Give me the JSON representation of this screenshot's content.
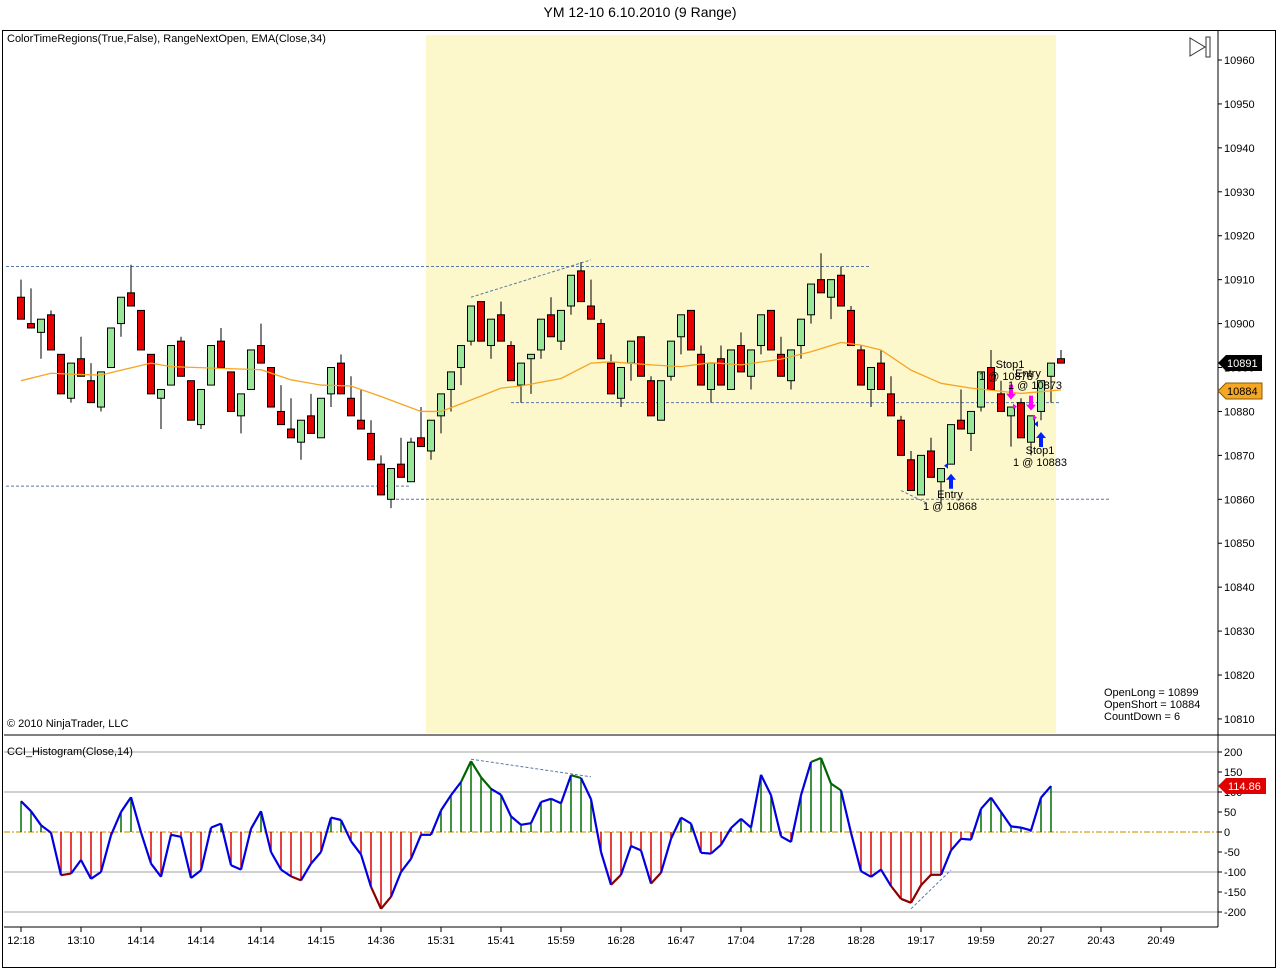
{
  "window": {
    "title": "YM 12-10  6.10.2010 (9 Range)"
  },
  "price_panel": {
    "indicator_label": "ColorTimeRegions(True,False), RangeNextOpen, EMA(Close,34)",
    "copyright": "© 2010 NinjaTrader, LLC",
    "info": [
      "OpenLong = 10899",
      "OpenShort = 10884",
      "CountDown = 6"
    ],
    "last_price_label": "10891",
    "ema_label": "10884",
    "trade_labels": [
      {
        "name": "Entry",
        "detail": "1 @ 10868",
        "bar": 92,
        "price": 10860
      },
      {
        "name": "Stop1",
        "detail": "1 @ 10878",
        "bar": 97,
        "price": 10894
      },
      {
        "name": "Entry",
        "detail": "1 @ 10873",
        "bar": 100,
        "price": 10891
      },
      {
        "name": "Stop1",
        "detail": "1 @ 10883",
        "bar": 101,
        "price": 10868
      }
    ]
  },
  "cci_panel": {
    "indicator_label": "CCI_Histogram(Close,14)",
    "last_value_label": "114.86"
  },
  "colors": {
    "up": "#99e699",
    "down": "#e60000",
    "ema": "#f5a623",
    "session": "#fdf7cc",
    "cci_line": "#0000e0",
    "cci_pos": "#007000",
    "cci_neg": "#e00000"
  },
  "chart_data": [
    {
      "type": "candlestick",
      "title": "YM 12-10  6.10.2010 (9 Range)",
      "ylim": [
        10805,
        10966
      ],
      "yticks": [
        "10960",
        "10950",
        "10940",
        "10930",
        "10920",
        "10910",
        "10900",
        "10890",
        "10880",
        "10870",
        "10860",
        "10850",
        "10840",
        "10830",
        "10820",
        "10810"
      ],
      "ytick_values": [
        10960,
        10950,
        10940,
        10930,
        10920,
        10910,
        10900,
        10890,
        10880,
        10870,
        10860,
        10850,
        10840,
        10830,
        10820,
        10810
      ],
      "xticks": [
        "12:18",
        "13:10",
        "14:14",
        "14:14",
        "14:14",
        "14:15",
        "14:36",
        "15:31",
        "15:41",
        "15:59",
        "16:28",
        "16:47",
        "17:04",
        "17:28",
        "18:28",
        "19:17",
        "19:59",
        "20:27",
        "20:43",
        "20:49"
      ],
      "xtick_every_bars": 6,
      "session_region_bars": [
        40.5,
        103.5
      ],
      "ohlc": [
        [
          10906,
          10910,
          10901,
          10901
        ],
        [
          10900,
          10908,
          10899,
          10899
        ],
        [
          10898,
          10901,
          10892,
          10901
        ],
        [
          10902,
          10903,
          10894,
          10894
        ],
        [
          10893,
          10893,
          10884,
          10884
        ],
        [
          10883,
          10891,
          10882,
          10891
        ],
        [
          10892,
          10897,
          10888,
          10888
        ],
        [
          10887,
          10891,
          10882,
          10882
        ],
        [
          10881,
          10889,
          10880,
          10889
        ],
        [
          10890,
          10899,
          10890,
          10899
        ],
        [
          10900,
          10906,
          10897,
          10906
        ],
        [
          10907,
          10913.4,
          10904,
          10904
        ],
        [
          10903,
          10903,
          10894,
          10894
        ],
        [
          10893,
          10893,
          10884,
          10884
        ],
        [
          10883,
          10885,
          10876,
          10885
        ],
        [
          10886,
          10895,
          10886,
          10895
        ],
        [
          10896,
          10897,
          10888,
          10888
        ],
        [
          10887,
          10887,
          10878,
          10878
        ],
        [
          10877,
          10885,
          10876,
          10885
        ],
        [
          10886,
          10895,
          10886,
          10895
        ],
        [
          10896,
          10899,
          10890,
          10890
        ],
        [
          10889,
          10889,
          10880,
          10880
        ],
        [
          10879,
          10884,
          10875,
          10884
        ],
        [
          10885,
          10894,
          10885,
          10894
        ],
        [
          10895,
          10900,
          10891,
          10891
        ],
        [
          10890,
          10890,
          10881,
          10881
        ],
        [
          10880,
          10886,
          10877,
          10877
        ],
        [
          10876,
          10883,
          10874,
          10874
        ],
        [
          10873,
          10878,
          10869,
          10878
        ],
        [
          10879,
          10884,
          10875,
          10875
        ],
        [
          10874,
          10883,
          10874,
          10883
        ],
        [
          10884,
          10890,
          10881,
          10890
        ],
        [
          10891,
          10893,
          10884,
          10884
        ],
        [
          10883,
          10888,
          10879,
          10879
        ],
        [
          10878,
          10885,
          10876,
          10876
        ],
        [
          10875,
          10878,
          10869,
          10869
        ],
        [
          10868,
          10870,
          10861,
          10861
        ],
        [
          10860,
          10867,
          10858,
          10867
        ],
        [
          10868,
          10874,
          10865,
          10865
        ],
        [
          10864,
          10874,
          10864,
          10873
        ],
        [
          10874,
          10881,
          10872,
          10872
        ],
        [
          10871,
          10878,
          10869,
          10878
        ],
        [
          10879,
          10884,
          10875,
          10884
        ],
        [
          10885,
          10889,
          10880,
          10889
        ],
        [
          10890,
          10895,
          10886,
          10895
        ],
        [
          10896,
          10904,
          10895,
          10904
        ],
        [
          10905,
          10905,
          10896,
          10896
        ],
        [
          10895,
          10901,
          10892,
          10901
        ],
        [
          10902,
          10905,
          10896,
          10896
        ],
        [
          10895,
          10896,
          10887,
          10887
        ],
        [
          10886,
          10891,
          10882,
          10891
        ],
        [
          10892,
          10893,
          10884,
          10893
        ],
        [
          10894,
          10901,
          10892,
          10901
        ],
        [
          10902,
          10906,
          10897,
          10897
        ],
        [
          10896,
          10903,
          10894,
          10903
        ],
        [
          10904,
          10911,
          10902,
          10911
        ],
        [
          10912,
          10914,
          10905,
          10905
        ],
        [
          10904,
          10910,
          10901,
          10901
        ],
        [
          10900,
          10901,
          10892,
          10892
        ],
        [
          10891,
          10893,
          10884,
          10884
        ],
        [
          10883,
          10890,
          10881,
          10890
        ],
        [
          10891,
          10896,
          10887,
          10896
        ],
        [
          10897,
          10897,
          10888,
          10888
        ],
        [
          10887,
          10888,
          10879,
          10879
        ],
        [
          10878,
          10887,
          10878,
          10887
        ],
        [
          10888,
          10896,
          10887,
          10896
        ],
        [
          10897,
          10902,
          10893,
          10902
        ],
        [
          10903,
          10903,
          10894,
          10894
        ],
        [
          10893,
          10895,
          10886,
          10886
        ],
        [
          10885,
          10891,
          10882,
          10891
        ],
        [
          10892,
          10895,
          10886,
          10886
        ],
        [
          10885,
          10894,
          10885,
          10894
        ],
        [
          10895,
          10898,
          10889,
          10889
        ],
        [
          10888,
          10894,
          10885,
          10894
        ],
        [
          10895,
          10902,
          10893,
          10902
        ],
        [
          10903,
          10903,
          10894,
          10894
        ],
        [
          10893,
          10897,
          10888,
          10888
        ],
        [
          10887,
          10894,
          10885,
          10894
        ],
        [
          10895,
          10901,
          10892,
          10901
        ],
        [
          10902,
          10909,
          10900,
          10909
        ],
        [
          10910,
          10916,
          10907,
          10907
        ],
        [
          10906,
          10910,
          10901,
          10910
        ],
        [
          10911,
          10913,
          10904,
          10904
        ],
        [
          10903,
          10904,
          10895,
          10895
        ],
        [
          10894,
          10895,
          10886,
          10886
        ],
        [
          10885,
          10890,
          10881,
          10890
        ],
        [
          10891,
          10894,
          10885,
          10885
        ],
        [
          10884,
          10888,
          10879,
          10879
        ],
        [
          10878,
          10879,
          10870,
          10870
        ],
        [
          10869,
          10871,
          10862,
          10862
        ],
        [
          10861,
          10870,
          10861,
          10870
        ],
        [
          10871,
          10874,
          10865,
          10865
        ],
        [
          10864,
          10867,
          10859,
          10867
        ],
        [
          10868,
          10877,
          10868,
          10877
        ],
        [
          10878,
          10885,
          10876,
          10876
        ],
        [
          10875,
          10880,
          10871,
          10880
        ],
        [
          10881,
          10889,
          10880,
          10889
        ],
        [
          10890,
          10894,
          10885,
          10885
        ],
        [
          10884,
          10887,
          10880,
          10880
        ],
        [
          10879,
          10881,
          10872,
          10881
        ],
        [
          10882,
          10883,
          10874,
          10874
        ],
        [
          10873,
          10879,
          10870,
          10879
        ],
        [
          10880,
          10887,
          10878,
          10887
        ],
        [
          10888,
          10891,
          10882,
          10891
        ],
        [
          10892,
          10894,
          10891,
          10891
        ]
      ],
      "ema34": [
        [
          0,
          10887
        ],
        [
          3,
          10888.7
        ],
        [
          6,
          10888.4
        ],
        [
          8,
          10888.3
        ],
        [
          13,
          10891
        ],
        [
          15,
          10890.2
        ],
        [
          20,
          10889.8
        ],
        [
          24,
          10889.5
        ],
        [
          27,
          10887.2
        ],
        [
          30,
          10886
        ],
        [
          33,
          10885.8
        ],
        [
          36,
          10883.4
        ],
        [
          40,
          10880
        ],
        [
          42,
          10880
        ],
        [
          45,
          10882.6
        ],
        [
          48,
          10885.3
        ],
        [
          50,
          10885.8
        ],
        [
          54,
          10887.5
        ],
        [
          57,
          10891
        ],
        [
          59,
          10891.3
        ],
        [
          63,
          10890.6
        ],
        [
          66,
          10890.2
        ],
        [
          69,
          10891.1
        ],
        [
          72,
          10890.6
        ],
        [
          76,
          10891.9
        ],
        [
          79,
          10893.6
        ],
        [
          82,
          10895.7
        ],
        [
          84,
          10895.1
        ],
        [
          86,
          10894
        ],
        [
          89,
          10889.4
        ],
        [
          92,
          10886.4
        ],
        [
          95,
          10885.3
        ],
        [
          100,
          10884.1
        ],
        [
          104,
          10884.9
        ]
      ],
      "horizontal_lines": [
        {
          "price": 10913,
          "from_bar": -1.5,
          "to_bar": 85
        },
        {
          "price": 10863,
          "from_bar": -1.5,
          "to_bar": 39
        },
        {
          "price": 10882,
          "from_bar": 49,
          "to_bar": 104
        },
        {
          "price": 10860,
          "from_bar": 37,
          "to_bar": 109
        }
      ],
      "trend_lines": [
        {
          "from": [
            45,
            10906
          ],
          "to": [
            57,
            10914.5
          ]
        },
        {
          "from": [
            88,
            10862
          ],
          "to": [
            90.7,
            10859
          ]
        }
      ],
      "markers": [
        {
          "type": "long-entry-arrow",
          "bar": 93,
          "price": 10864
        },
        {
          "type": "long-entry-arrow",
          "bar": 102,
          "price": 10873.5
        },
        {
          "type": "short-exit-arrow",
          "bar": 99,
          "price": 10884.5
        },
        {
          "type": "short-exit-arrow",
          "bar": 101,
          "price": 10882
        }
      ]
    },
    {
      "type": "bar+line",
      "title": "CCI_Histogram(Close,14)",
      "ylim": [
        -240,
        230
      ],
      "yticks": [
        "200",
        "150",
        "100",
        "50",
        "0",
        "-50",
        "-100",
        "-150",
        "-200"
      ],
      "ytick_values": [
        200,
        150,
        100,
        50,
        0,
        -50,
        -100,
        -150,
        -200
      ],
      "gridlines": [
        200,
        100,
        -100,
        -200
      ],
      "values": [
        77,
        52,
        17,
        -2,
        -108,
        -104,
        -70,
        -117,
        -100,
        -8,
        50,
        87,
        -1,
        -79,
        -112,
        -7,
        -12,
        -115,
        -96,
        11,
        21,
        -83,
        -94,
        8,
        52,
        -50,
        -94,
        -111,
        -121,
        -79,
        -50,
        36,
        30,
        -23,
        -56,
        -137,
        -192,
        -162,
        -100,
        -67,
        -7,
        -7,
        54,
        92,
        125,
        177,
        137,
        108,
        93,
        39,
        18,
        22,
        75,
        83,
        72,
        142,
        135,
        82,
        -50,
        -132,
        -107,
        -35,
        -46,
        -129,
        -102,
        -17,
        36,
        21,
        -52,
        -54,
        -32,
        10,
        33,
        11,
        143,
        92,
        -11,
        -25,
        92,
        175,
        185,
        121,
        104,
        -2,
        -98,
        -112,
        -94,
        -135,
        -167,
        -177,
        -133,
        -107,
        -107,
        -46,
        -17,
        -19,
        58,
        86,
        50,
        14,
        11,
        4,
        86,
        114.86
      ],
      "trend_lines": [
        {
          "from": [
            45,
            182
          ],
          "to": [
            57,
            138
          ]
        },
        {
          "from": [
            89,
            -192
          ],
          "to": [
            93,
            -95
          ]
        }
      ]
    }
  ]
}
